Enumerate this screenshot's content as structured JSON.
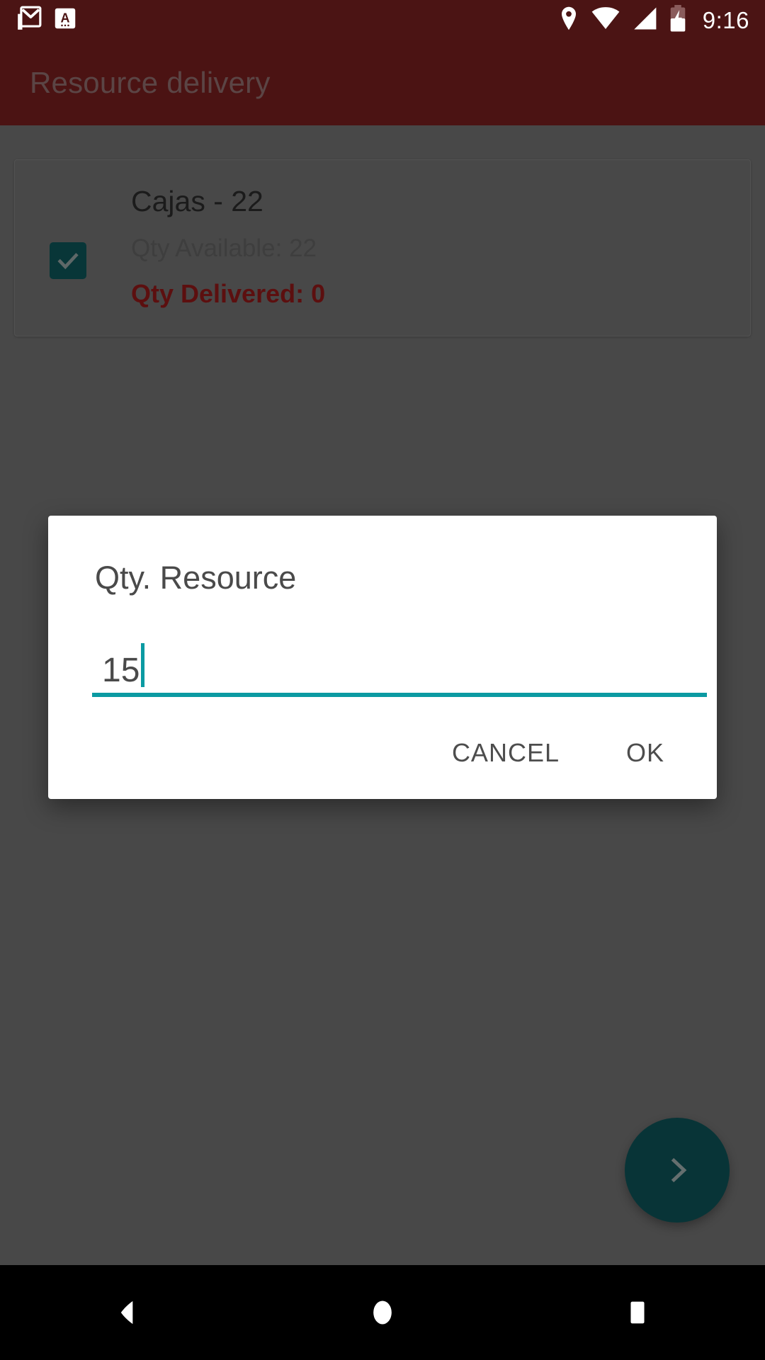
{
  "status_bar": {
    "background": "#4b1414",
    "clock": "9:16",
    "left_icons": [
      {
        "name": "gmail-icon",
        "label": "Gmail"
      },
      {
        "name": "app-a-icon",
        "label": "A"
      }
    ],
    "right_icons": [
      {
        "name": "location-pin-icon",
        "label": "Location"
      },
      {
        "name": "wifi-icon",
        "label": "Wi-Fi"
      },
      {
        "name": "cell-signal-icon",
        "label": "Signal"
      },
      {
        "name": "battery-charging-icon",
        "label": "Battery charging"
      }
    ]
  },
  "app_bar": {
    "title": "Resource delivery",
    "background": "#731e1e",
    "title_color": "#8a6a6a"
  },
  "card": {
    "title": "Cajas - 22",
    "qty_available": "Qty Available: 22",
    "qty_delivered": "Qty Delivered: 0",
    "checkbox_checked": true,
    "checkbox_color": "#0d5355",
    "delivered_color": "#8c1818"
  },
  "fab": {
    "icon": "chevron-right-icon",
    "color": "#0d5054"
  },
  "dialog": {
    "title": "Qty. Resource",
    "input_value": "15",
    "input_placeholder": "",
    "accent_color": "#0b9aa2",
    "cancel_label": "CANCEL",
    "ok_label": "OK"
  },
  "nav_bar": {
    "back_label": "Back",
    "home_label": "Home",
    "recents_label": "Recent apps"
  }
}
